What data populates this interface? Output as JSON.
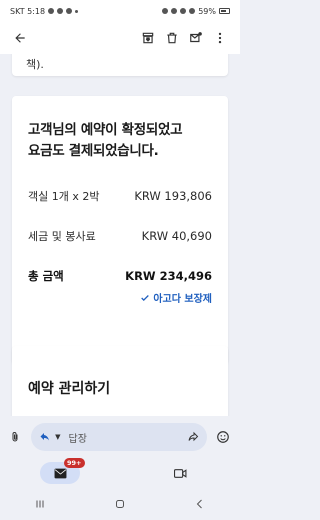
{
  "status": {
    "carrier_time": "SKT 5:18",
    "battery": "59%"
  },
  "toolbar": {
    "back_icon": "back-arrow-icon",
    "archive_icon": "archive-icon",
    "delete_icon": "trash-icon",
    "mark_unread_icon": "mark-unread-icon",
    "more_icon": "more-vert-icon"
  },
  "email": {
    "fragment_text": "책).",
    "heading_line1": "고객님의 예약이 확정되었고",
    "heading_line2": "요금도 결제되었습니다.",
    "rows": [
      {
        "label": "객실 1개 x 2박",
        "amount": "KRW 193,806"
      },
      {
        "label": "세금 및 봉사료",
        "amount": "KRW 40,690"
      }
    ],
    "total": {
      "label": "총 금액",
      "amount": "KRW 234,496"
    },
    "guarantee_label": "아고다 보장제",
    "manage_title": "예약 관리하기"
  },
  "reply": {
    "placeholder": "답장"
  },
  "nav": {
    "mail_badge": "99+"
  },
  "colors": {
    "accent_blue": "#1f5fbf",
    "background": "#eef0f6",
    "reply_pill": "#dde3f1",
    "badge_red": "#c9302c"
  }
}
